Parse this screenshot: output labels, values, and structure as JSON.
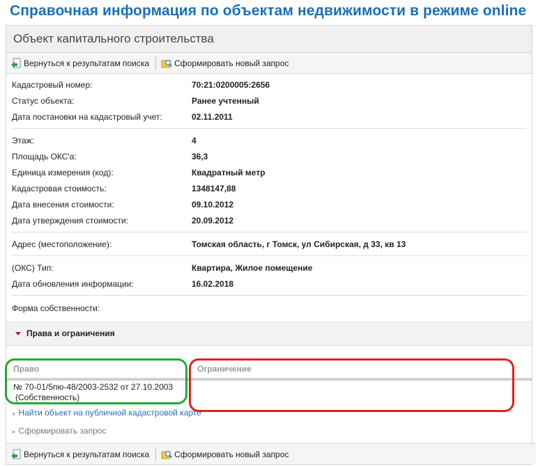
{
  "page_title": "Справочная информация по объектам недвижимости в режиме online",
  "panel_title": "Объект капитального строительства",
  "toolbar": {
    "back_label": "Вернуться к результатам поиска",
    "new_request_label": "Сформировать новый запрос"
  },
  "fields": {
    "cad_number": {
      "label": "Кадастровый номер:",
      "value": "70:21:0200005:2656"
    },
    "status": {
      "label": "Статус объекта:",
      "value": "Ранее учтенный"
    },
    "reg_date": {
      "label": "Дата постановки на кадастровый учет:",
      "value": "02.11.2011"
    },
    "floor": {
      "label": "Этаж:",
      "value": "4"
    },
    "area": {
      "label": "Площадь ОКС'a:",
      "value": "36,3"
    },
    "unit": {
      "label": "Единица измерения (код):",
      "value": "Квадратный метр"
    },
    "cad_cost": {
      "label": "Кадастровая стоимость:",
      "value": "1348147,88"
    },
    "cost_date": {
      "label": "Дата внесения стоимости:",
      "value": "09.10.2012"
    },
    "cost_approve_date": {
      "label": "Дата утверждения стоимости:",
      "value": "20.09.2012"
    },
    "address": {
      "label": "Адрес (местоположение):",
      "value": "Томская область, г Томск, ул Сибирская, д 33, кв 13"
    },
    "oks_type": {
      "label": "(ОКС) Тип:",
      "value": "Квартира, Жилое помещение"
    },
    "update_date": {
      "label": "Дата обновления информации:",
      "value": "16.02.2018"
    },
    "ownership": {
      "label": "Форма собственности:",
      "value": ""
    }
  },
  "rights": {
    "section_title": "Права и ограничения",
    "col_right": "Право",
    "col_restriction": "Ограничение",
    "right_line1": "№ 70-01/5пю-48/2003-2532  от 27.10.2003",
    "right_line2": "(Собственность)"
  },
  "links": {
    "map": "Найти объект на публичной кадастровой карте",
    "request": "Сформировать запрос"
  },
  "colors": {
    "title": "#1a6fb8",
    "link": "#2a6db2",
    "green_mark": "#22aa33",
    "red_mark": "#e02020"
  }
}
